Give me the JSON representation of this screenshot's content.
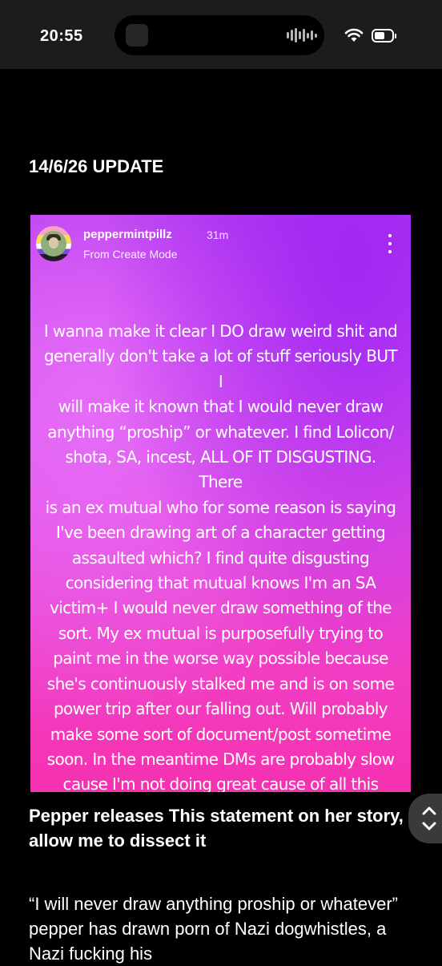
{
  "status_bar": {
    "time": "20:55",
    "battery_level": 0.6,
    "icons": [
      "dynamic-island",
      "audio-waveform-icon",
      "wifi-icon",
      "battery-icon"
    ]
  },
  "post": {
    "headline": "14/6/26 UPDATE",
    "story": {
      "username": "peppermintpillz",
      "time_ago": "31m",
      "mode": "From Create Mode",
      "text": "I wanna make it clear I DO draw weird shit and\ngenerally don't take a lot of stuff seriously BUT I\nwill make it known that I would never draw\nanything “proship” or whatever. I find Lolicon/\nshota, SA, incest, ALL OF IT DISGUSTING. There\nis an ex mutual who for some reason is saying\nI've been drawing art of a character getting\nassaulted which? I find quite disgusting\nconsidering that mutual knows I'm an SA\nvictim+ I would never draw something of the\nsort. My ex mutual is purposefully trying to\npaint me in the worse way possible because\nshe's continuously stalked me and is on some\npower trip after our falling out. Will probably\nmake some sort of document/post sometime\nsoon. In the meantime DMs are probably slow\ncause I'm not doing great cause of all this",
      "colors": {
        "top": "#b03af0",
        "middle": "#e94fe0",
        "bottom": "#f532b0"
      }
    },
    "subheading": "Pepper releases This statement on her story, allow me to dissect it",
    "body": "“I will never draw anything proship or whatever” pepper has drawn porn of Nazi dogwhistles, a Nazi fucking his"
  }
}
